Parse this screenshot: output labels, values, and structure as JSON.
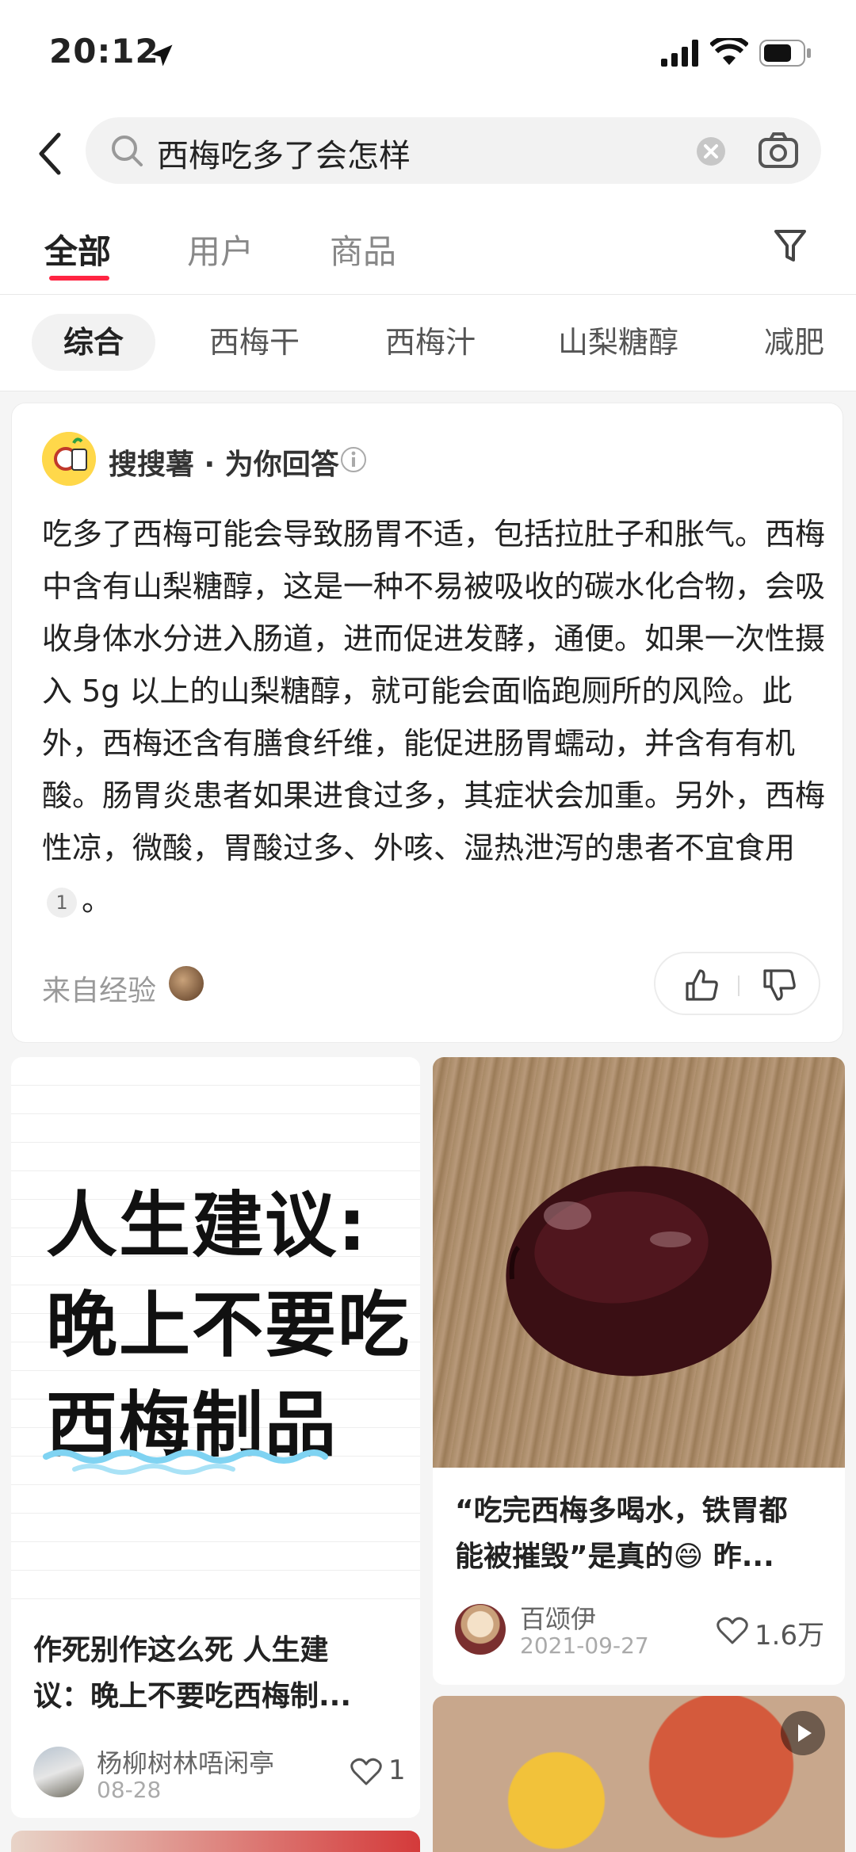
{
  "status_bar": {
    "time": "20:12"
  },
  "search": {
    "query": "西梅吃多了会怎样"
  },
  "tabs": [
    {
      "label": "全部",
      "active": true
    },
    {
      "label": "用户",
      "active": false
    },
    {
      "label": "商品",
      "active": false
    }
  ],
  "chips": [
    {
      "label": "综合",
      "active": true
    },
    {
      "label": "西梅干",
      "active": false
    },
    {
      "label": "西梅汁",
      "active": false
    },
    {
      "label": "山梨糖醇",
      "active": false
    },
    {
      "label": "减肥",
      "active": false
    }
  ],
  "answer": {
    "source": "搜搜薯 · 为你回答",
    "text": "吃多了西梅可能会导致肠胃不适，包括拉肚子和胀气。西梅中含有山梨糖醇，这是一种不易被吸收的碳水化合物，会吸收身体水分进入肠道，进而促进发酵，通便。如果一次性摄入 5g 以上的山梨糖醇，就可能会面临跑厕所的风险。此外，西梅还含有膳食纤维，能促进肠胃蠕动，并含有有机酸。肠胃炎患者如果进食过多，其症状会加重。另外，西梅性凉，微酸，胃酸过多、外咳、湿热泄泻的患者不宜食用",
    "citation": "1",
    "text_end": "。",
    "from_label": "来自经验"
  },
  "notes": [
    {
      "cover_lines": [
        "人生建议:",
        "晚上不要吃",
        "西梅制品"
      ],
      "title_line1": "作死别作这么死 人生建",
      "title_line2": "议：晚上不要吃西梅制...",
      "author": "杨柳树林唔闲亭",
      "date": "08-28",
      "likes": "1"
    },
    {
      "title_line1": "“吃完西梅多喝水，铁胃都",
      "title_line2": "能被摧毁”是真的😄 昨...",
      "author": "百颂伊",
      "date": "2021-09-27",
      "likes": "1.6万"
    }
  ],
  "colors": {
    "accent": "#ff2442",
    "background": "#f5f5f5"
  }
}
